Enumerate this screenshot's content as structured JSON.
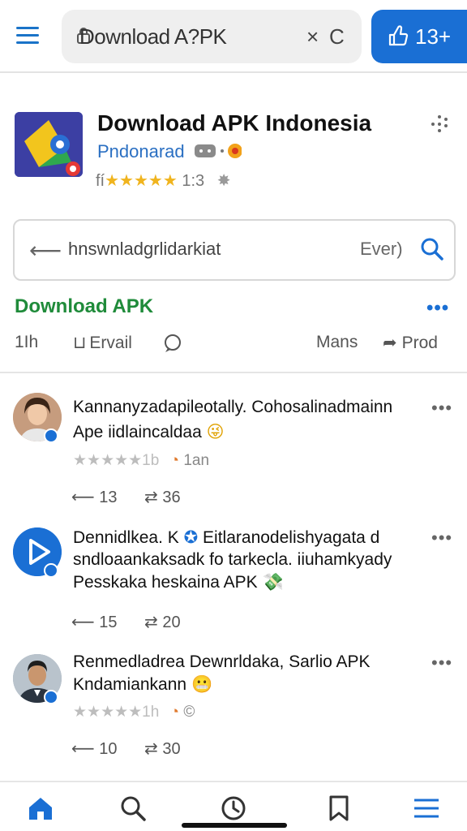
{
  "topbar": {
    "url_text": "Download A?PK",
    "close_label": "×",
    "reload_label": "C",
    "like_count": "13+"
  },
  "app": {
    "title": "Download APK Indonesia",
    "subtitle": "Pndonarad",
    "stars": "★★★★★",
    "rating_prefix": "fí",
    "rating_value": "1:3"
  },
  "search": {
    "text": "hnswnladgrlidarkiat",
    "hint": "Ever)"
  },
  "section": {
    "title": "Download APK",
    "more": "•••"
  },
  "tabs": {
    "left_count": "1Ih",
    "email": "Ervail",
    "mans": "Mans",
    "prod": "Prod"
  },
  "posts": [
    {
      "name": "Kannanyzadapileotally. Cohosalinadmainn",
      "line1": "Ape iidlaincaldaa",
      "line2": "",
      "meta_stars": "★★★★★1b",
      "meta_time": "1an",
      "reply_count": "13",
      "repost_count": "36"
    },
    {
      "name": "Dennidlkea. K",
      "line1": "sndloaankaksadk fo tarkecla. iiuhamkyady",
      "line2": "Pesskaka heskaina APK",
      "meta_stars": "",
      "meta_time": "",
      "reply_count": "15",
      "repost_count": "20",
      "name_suffix": "Eitlaranodelishyagata d"
    },
    {
      "name": "Renmedladrea Dewnrldaka, Sarlio APK",
      "line1": "Kndamiankann",
      "line2": "",
      "meta_stars": "★★★★★1h",
      "meta_time": "©",
      "reply_count": "10",
      "repost_count": "30"
    }
  ],
  "colors": {
    "accent": "#1a6fd4",
    "section_green": "#1f8b3a"
  }
}
